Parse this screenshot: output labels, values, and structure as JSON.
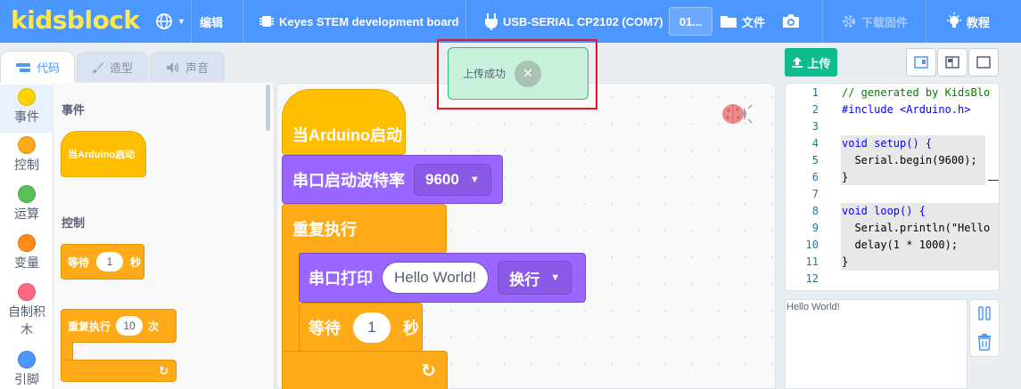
{
  "app": {
    "logo": "kidsblock"
  },
  "menu": {
    "globe_icon": "globe-icon",
    "edit_label": "编辑",
    "board_label": "Keyes STEM development board",
    "port_label": "USB-SERIAL CP2102 (COM7)",
    "port_box": "01...",
    "file_label": "文件",
    "firmware_label": "下载固件",
    "tutorial_label": "教程"
  },
  "tabs": [
    {
      "label": "代码",
      "icon": "code-icon"
    },
    {
      "label": "造型",
      "icon": "brush-icon"
    },
    {
      "label": "声音",
      "icon": "speaker-icon"
    }
  ],
  "categories": [
    {
      "label": "事件",
      "color": "#ffd500"
    },
    {
      "label": "控制",
      "color": "#ffab19"
    },
    {
      "label": "运算",
      "color": "#59c059"
    },
    {
      "label": "变量",
      "color": "#ff8c1a"
    },
    {
      "label": "自制积木",
      "color": "#ff6680"
    },
    {
      "label": "引脚",
      "color": "#4c97ff"
    }
  ],
  "flyout": {
    "events_heading": "事件",
    "when_start": "当Arduino启动",
    "control_heading": "控制",
    "wait_label": "等待",
    "wait_value": "1",
    "wait_unit": "秒",
    "repeat_label": "重复执行",
    "repeat_value": "10",
    "repeat_unit": "次"
  },
  "workspace": {
    "when_start": "当Arduino启动",
    "serial_begin": "串口启动波特率",
    "baud_value": "9600",
    "forever": "重复执行",
    "serial_print": "串口打印",
    "print_text": "Hello World!",
    "newline_option": "换行",
    "wait_label": "等待",
    "wait_value": "1",
    "wait_unit": "秒"
  },
  "toast": {
    "message": "上传成功"
  },
  "right_panel": {
    "upload_label": "上传",
    "serial_output": "Hello World!"
  },
  "code_lines": [
    {
      "n": "1",
      "text": "// generated by KidsBlo"
    },
    {
      "n": "2",
      "text": "#include <Arduino.h>"
    },
    {
      "n": "3",
      "text": ""
    },
    {
      "n": "4",
      "text": "void setup() {"
    },
    {
      "n": "5",
      "text": "  Serial.begin(9600);"
    },
    {
      "n": "6",
      "text": "}"
    },
    {
      "n": "7",
      "text": ""
    },
    {
      "n": "8",
      "text": "void loop() {"
    },
    {
      "n": "9",
      "text": "  Serial.println(\"Hello"
    },
    {
      "n": "10",
      "text": "  delay(1 * 1000);"
    },
    {
      "n": "11",
      "text": "}"
    },
    {
      "n": "12",
      "text": ""
    }
  ]
}
